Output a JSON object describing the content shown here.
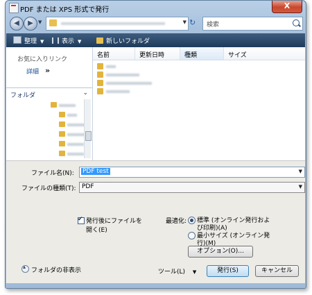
{
  "window": {
    "title": "PDF または XPS 形式で発行",
    "close_glyph": "X"
  },
  "nav": {
    "search_placeholder": "検索"
  },
  "toolbar": {
    "organize": "整理",
    "views": "表示",
    "new_folder": "新しいフォルダ"
  },
  "left_pane": {
    "favorites": "お気に入りリンク",
    "details": "詳細",
    "details_arrows": "»",
    "folders": "フォルダ"
  },
  "columns": {
    "name": "名前",
    "date": "更新日時",
    "type": "種類",
    "size": "サイズ"
  },
  "form": {
    "filename_label": "ファイル名(N):",
    "filename_value": "PDF test",
    "filetype_label": "ファイルの種類(T):",
    "filetype_value": "PDF",
    "open_after_publish_line1": "発行後にファイルを",
    "open_after_publish_line2": "開く(E)",
    "optimize_label": "最適化:",
    "standard_line1": "標準 (オンライン発行およ",
    "standard_line2": "び印刷)(A)",
    "minimum_line1": "最小サイズ (オンライン発",
    "minimum_line2": "行)(M)",
    "options_button": "オプション(O)...",
    "hide_folders": "フォルダの非表示",
    "tools": "ツール(L)",
    "tools_arrow": "▼",
    "publish_button": "発行(S)",
    "cancel_button": "キャンセル"
  },
  "colors": {
    "toolbar_bg": "#1e3b5a",
    "frame": "#a8c2de",
    "selection": "#3399ff",
    "close_button": "#c8482c"
  }
}
